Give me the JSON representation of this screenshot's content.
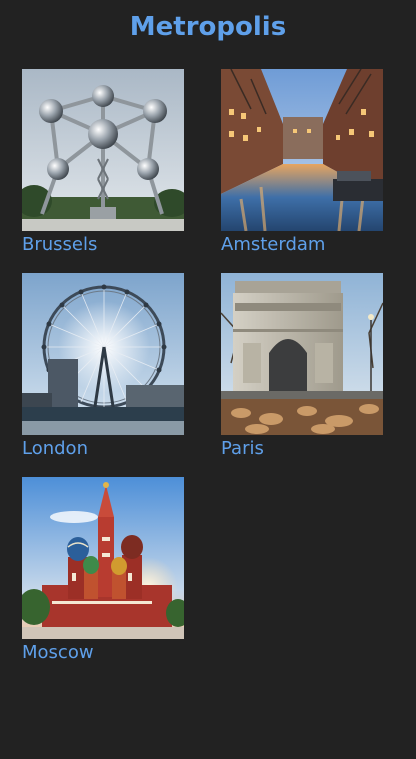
{
  "app": {
    "title": "Metropolis"
  },
  "colors": {
    "background": "#222222",
    "accent": "#5fa0ea"
  },
  "cities": [
    {
      "label": "Brussels",
      "icon": "atomium-photo"
    },
    {
      "label": "Amsterdam",
      "icon": "canal-photo"
    },
    {
      "label": "London",
      "icon": "london-eye-photo"
    },
    {
      "label": "Paris",
      "icon": "arc-de-triomphe-photo"
    },
    {
      "label": "Moscow",
      "icon": "st-basils-cathedral-photo"
    }
  ]
}
